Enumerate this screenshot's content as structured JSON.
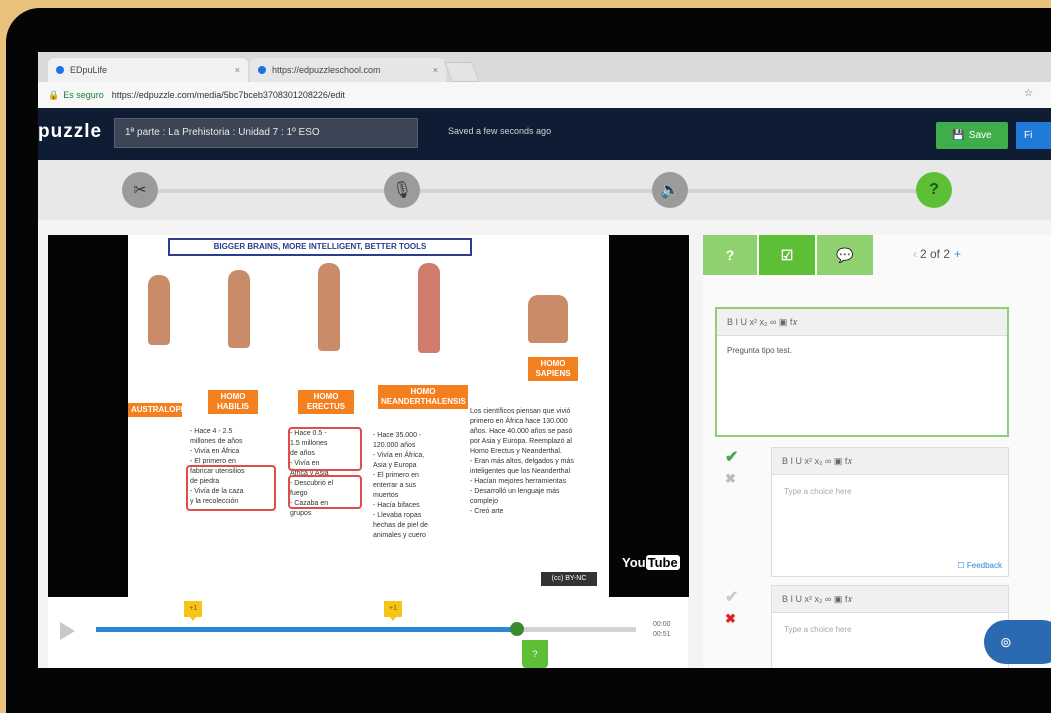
{
  "browser": {
    "tabs": [
      {
        "label": "EDpuLife"
      },
      {
        "label": "https://edpuzzleschool.com"
      }
    ],
    "secure_label": "Es seguro",
    "url": "https://edpuzzle.com/media/5bc7bceb3708301208226/edit"
  },
  "app": {
    "logo": "puzzle",
    "video_title": "1ª parte : La Prehistoria : Unidad 7 : 1º ESO",
    "saved_status": "Saved a few seconds ago",
    "save_label": "Save",
    "publish_label": "Fi"
  },
  "tools": [
    {
      "icon": "scissors-icon",
      "glyph": "✂"
    },
    {
      "icon": "microphone-icon",
      "glyph": "🎙"
    },
    {
      "icon": "audio-note-icon",
      "glyph": "🔈"
    },
    {
      "icon": "question-icon",
      "glyph": "?"
    }
  ],
  "slide": {
    "title": "BIGGER BRAINS, MORE INTELLIGENT, BETTER TOOLS",
    "species": [
      {
        "name": "AUSTRALOPITHECUS"
      },
      {
        "name": "HOMO HABILIS"
      },
      {
        "name": "HOMO ERECTUS"
      },
      {
        "name": "HOMO NEANDERTHALENSIS"
      },
      {
        "name": "HOMO SAPIENS"
      }
    ],
    "notes": [
      "- Hace 4 - 2.5\nmillones de años\n- Vivía en África\n- El primero en\nfabricar utensilios\nde piedra\n- Vivía de la caza\ny la recolección",
      "- Hace 0.5 -\n1.5 millones\nde años\n- Vivía en\nÁfrica y Asia\n- Descubrió el\nfuego\n- Cazaba en\ngrupos",
      "- Hace 35.000 -\n120.000 años\n- Vivía en África,\nAsia y Europa\n- El primero en\nenterrar a sus\nmuertos\n- Hacía bifaces\n- Llevaba ropas\nhechas de piel de\nanimales y cuero",
      "Los científicos piensan que vivió\nprimero en África hace 130.000\naños. Hace 40.000 años se pasó\npor Asia y Europa. Reemplazó al\nHomo Erectus y Neanderthal.\n- Eran más altos, delgados y más\ninteligentes que los Neanderthal\n- Hacían mejores herramientas\n- Desarrolló un lenguaje más\ncomplejo\n- Creó arte"
    ],
    "cc_label": "(cc) BY-NC",
    "youtube_label": "You",
    "youtube_tube": "Tube"
  },
  "player": {
    "progress": 0.78,
    "markers": [
      0.18,
      0.55
    ],
    "time_current": "00:00",
    "time_total": "00:51",
    "marker_label": "+1",
    "question_flag": "?"
  },
  "question_panel": {
    "tabs": [
      {
        "icon": "question-icon",
        "glyph": "?"
      },
      {
        "icon": "multiple-choice-icon",
        "glyph": "☑"
      },
      {
        "icon": "comment-icon",
        "glyph": "💬"
      }
    ],
    "pager": "2 of 2",
    "toolbar": "B  I  U   x²  x₂   ∞  ▣   f𝑥",
    "question_text": "Pregunta tipo test.",
    "choice_placeholder": "Type a choice here",
    "feedback_label": "Feedback"
  },
  "colors": {
    "header": "#0f1d34",
    "accent_green": "#5cbf36",
    "save_green": "#3fae4a",
    "seek_blue": "#2a86d8",
    "marker_yellow": "#f6c318"
  }
}
